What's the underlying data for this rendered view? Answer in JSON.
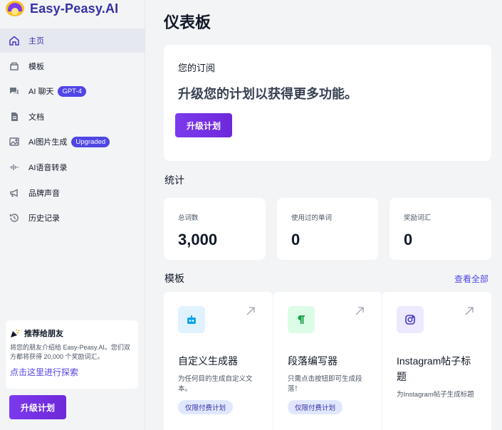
{
  "app": {
    "name": "Easy-Peasy.AI"
  },
  "sidebar": {
    "items": [
      {
        "label": "主页",
        "icon": "home-icon",
        "active": true
      },
      {
        "label": "模板",
        "icon": "templates-icon"
      },
      {
        "label": "AI 聊天",
        "icon": "chat-icon",
        "badge": "GPT-4"
      },
      {
        "label": "文档",
        "icon": "document-icon"
      },
      {
        "label": "AI图片生成",
        "icon": "image-icon",
        "badge": "Upgraded"
      },
      {
        "label": "AI语音转录",
        "icon": "audio-wave-icon"
      },
      {
        "label": "品牌声音",
        "icon": "megaphone-icon"
      },
      {
        "label": "历史记录",
        "icon": "history-icon"
      }
    ],
    "referral": {
      "title": "推荐给朋友",
      "description": "将您的朋友介绍给 Easy-Peasy.AI。您们双方都将获得 20,000 个奖励词汇。",
      "link": "点击这里进行探索"
    },
    "upgrade_label": "升级计划"
  },
  "main": {
    "title": "仪表板",
    "subscription": {
      "label": "您的订阅",
      "headline": "升级您的计划以获得更多功能。",
      "button": "升级计划"
    },
    "stats_title": "统计",
    "stats": [
      {
        "name": "总词数",
        "value": "3,000"
      },
      {
        "name": "使用过的单词",
        "value": "0"
      },
      {
        "name": "奖励词汇",
        "value": "0"
      }
    ],
    "templates_title": "模板",
    "view_all": "查看全部",
    "templates": [
      {
        "title": "自定义生成器",
        "description": "为任何目的生成自定义文本。",
        "badge": "仅限付费计划",
        "icon": "robot-icon"
      },
      {
        "title": "段落编写器",
        "description": "只需点击按钮即可生成段落！",
        "badge": "仅限付费计划",
        "icon": "pilcrow-icon"
      },
      {
        "title": "Instagram帖子标题",
        "description": "为Instagram帖子生成标题",
        "icon": "instagram-icon"
      }
    ]
  },
  "colors": {
    "accent": "#4f46e5",
    "brand_purple": "#7c3aed"
  }
}
